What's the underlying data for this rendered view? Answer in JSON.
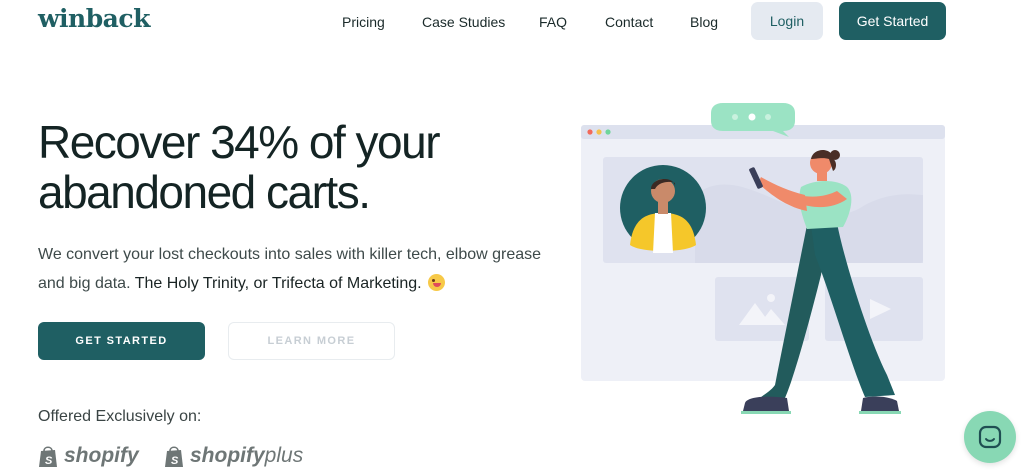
{
  "brand": {
    "logo_text": "winback",
    "primary_color": "#1f5f63",
    "accent_color": "#88d8b4"
  },
  "nav": {
    "links": [
      "Pricing",
      "Case Studies",
      "FAQ",
      "Contact",
      "Blog"
    ],
    "login_label": "Login",
    "get_started_label": "Get Started"
  },
  "hero": {
    "title_line1": "Recover 34% of your",
    "title_line2": "abandoned carts.",
    "subtitle": "We convert your lost checkouts into sales with killer tech, elbow grease and big data.",
    "subtitle_strong": "The Holy Trinity, or Trifecta of Marketing.",
    "emoji_icon": "winking-face-tongue-emoji",
    "cta_primary": "GET STARTED",
    "cta_secondary": "LEARN MORE"
  },
  "partners": {
    "heading": "Offered Exclusively on:",
    "shopify": "shopify",
    "shopify_plus_main": "shopify",
    "shopify_plus_suffix": "plus"
  },
  "chat": {
    "icon": "chat-bubble-icon"
  }
}
